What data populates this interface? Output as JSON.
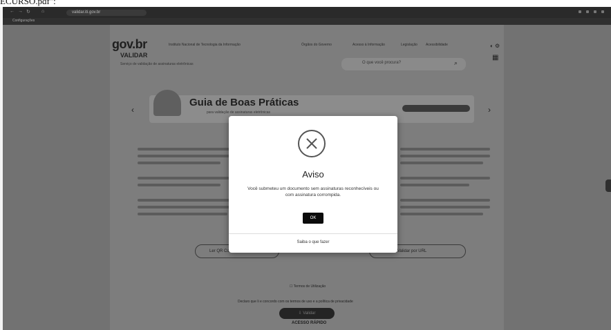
{
  "document": {
    "filename_fragment": "ECURSO.pdf\":"
  },
  "browser": {
    "url": "validar.iti.gov.br",
    "bookmark": "Configurações"
  },
  "header": {
    "logo": "gov.br",
    "logo_sub": "VALIDAR",
    "tagline": "Serviço de validação de assinaturas eletrônicas",
    "links": [
      "Instituto Nacional de Tecnologia da Informação",
      "Órgãos do Governo",
      "Acesso à Informação",
      "Legislação",
      "Acessibilidade"
    ],
    "search_placeholder": "O que você procura?"
  },
  "banner": {
    "title": "Guia de Boas Práticas",
    "subtitle": "para validação de assinaturas eletrônicas"
  },
  "actions": {
    "left": "Ler QR Code",
    "right": "Validar por URL",
    "terms": "Termos de Utilização",
    "consent": "Declaro que li e concordo com os termos de uso e a política de privacidade",
    "verify": "Validar",
    "quick_access": "ACESSO RÁPIDO"
  },
  "modal": {
    "title": "Aviso",
    "message": "Você submeteu um documento sem assinaturas reconhecíveis ou com assinatura corrompida.",
    "ok_label": "OK",
    "link": "Saiba o que fazer"
  }
}
